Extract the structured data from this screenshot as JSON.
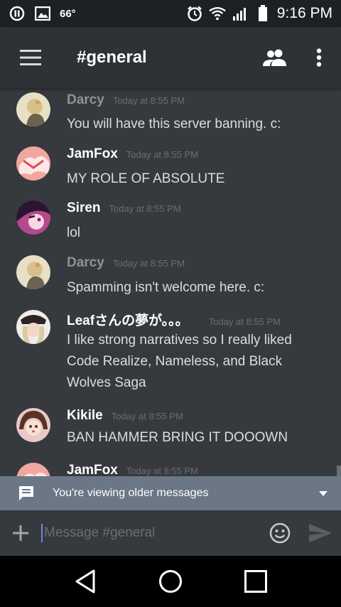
{
  "status": {
    "temperature": "66°",
    "time": "9:16 PM",
    "icons": [
      "pause-circle-icon",
      "image-icon",
      "alarm-icon",
      "wifi-icon",
      "signal-icon",
      "battery-icon"
    ]
  },
  "toolbar": {
    "channel": "#general",
    "icons": [
      "hamburger-menu-icon",
      "members-icon",
      "more-vert-icon"
    ]
  },
  "messages": [
    {
      "author": "Darcy",
      "author_color": "#8e9297",
      "time": "Today at 8:55 PM",
      "text": "You will have this server banning. c:"
    },
    {
      "author": "JamFox",
      "author_color": "#ffffff",
      "time": "Today at 8:55 PM",
      "text": "MY ROLE OF ABSOLUTE"
    },
    {
      "author": "Siren",
      "author_color": "#ffffff",
      "time": "Today at 8:55 PM",
      "text": "lol"
    },
    {
      "author": "Darcy",
      "author_color": "#8e9297",
      "time": "Today at 8:55 PM",
      "text": "Spamming isn't welcome here. c:"
    },
    {
      "author": "Leafさんの夢が。。。",
      "author_color": "#ffffff",
      "time": "Today at 8:55 PM",
      "text": "I like strong narratives so I really liked Code Realize, Nameless,  and Black Wolves Saga"
    },
    {
      "author": "Kikile",
      "author_color": "#ffffff",
      "time": "Today at 8:55 PM",
      "text": "BAN HAMMER BRING IT DOOOWN"
    },
    {
      "author": "JamFox",
      "author_color": "#ffffff",
      "time": "Today at 8:55 PM",
      "text": ""
    }
  ],
  "banner": {
    "text": "You're viewing older messages"
  },
  "composer": {
    "placeholder": "Message #general"
  },
  "colors": {
    "background": "#36393e",
    "toolbar": "#2e3136",
    "statusbar": "#1e2124",
    "banner": "#6b7785",
    "accent": "#7289da"
  }
}
